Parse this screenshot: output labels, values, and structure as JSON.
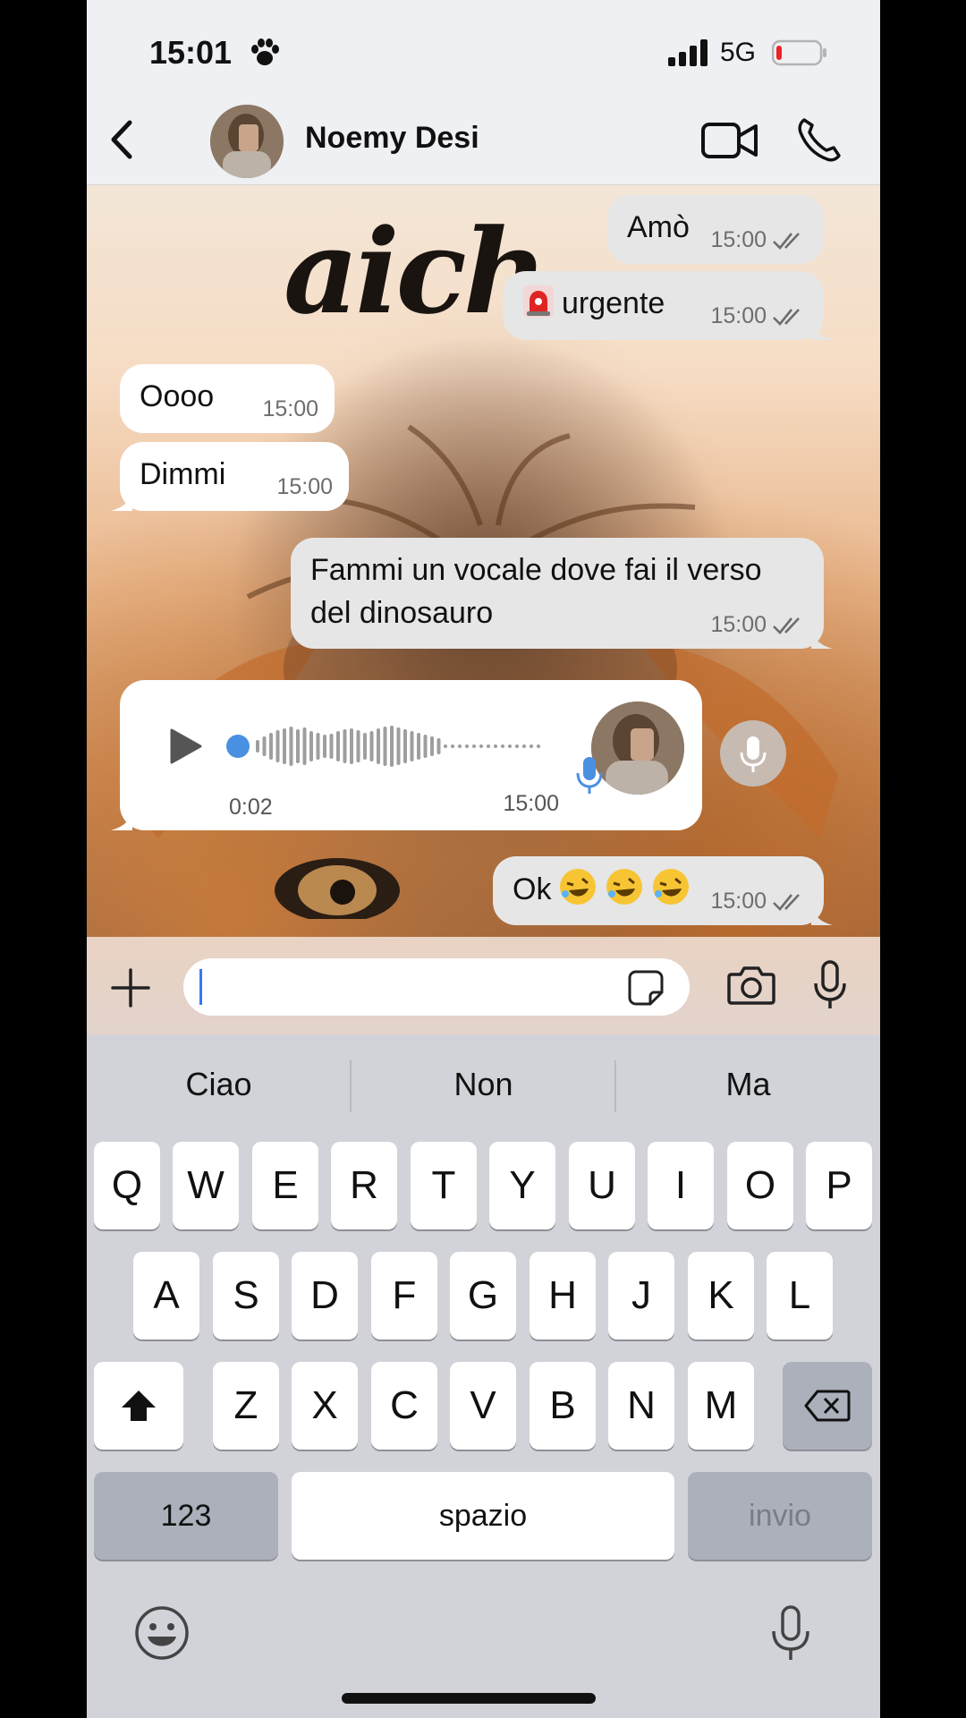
{
  "status": {
    "time": "15:01",
    "network": "5G"
  },
  "header": {
    "contact_name": "Noemy Desi"
  },
  "wallpaper": {
    "text": "aich"
  },
  "messages": [
    {
      "direction": "out",
      "text": "Amò",
      "time": "15:00"
    },
    {
      "direction": "out",
      "text": "urgente",
      "time": "15:00"
    },
    {
      "direction": "in",
      "text": "Oooo",
      "time": "15:00"
    },
    {
      "direction": "in",
      "text": "Dimmi",
      "time": "15:00"
    },
    {
      "direction": "out",
      "line1": "Fammi un vocale dove fai il verso",
      "line2": "del dinosauro",
      "time": "15:00"
    },
    {
      "direction": "out",
      "text": "Ok",
      "time": "15:00"
    }
  ],
  "voice_message": {
    "duration": "0:02",
    "time": "15:00",
    "progress": 0.0
  },
  "input": {
    "placeholder": ""
  },
  "keyboard": {
    "suggestions": [
      "Ciao",
      "Non",
      "Ma"
    ],
    "row1": [
      "Q",
      "W",
      "E",
      "R",
      "T",
      "Y",
      "U",
      "I",
      "O",
      "P"
    ],
    "row2": [
      "A",
      "S",
      "D",
      "F",
      "G",
      "H",
      "J",
      "K",
      "L"
    ],
    "row3": [
      "Z",
      "X",
      "C",
      "V",
      "B",
      "N",
      "M"
    ],
    "numbers_label": "123",
    "space_label": "spazio",
    "send_label": "invio"
  },
  "colors": {
    "check_ticks": "#6d6d6d",
    "voice_accent": "#4a90e2",
    "cursor": "#3478f6"
  }
}
